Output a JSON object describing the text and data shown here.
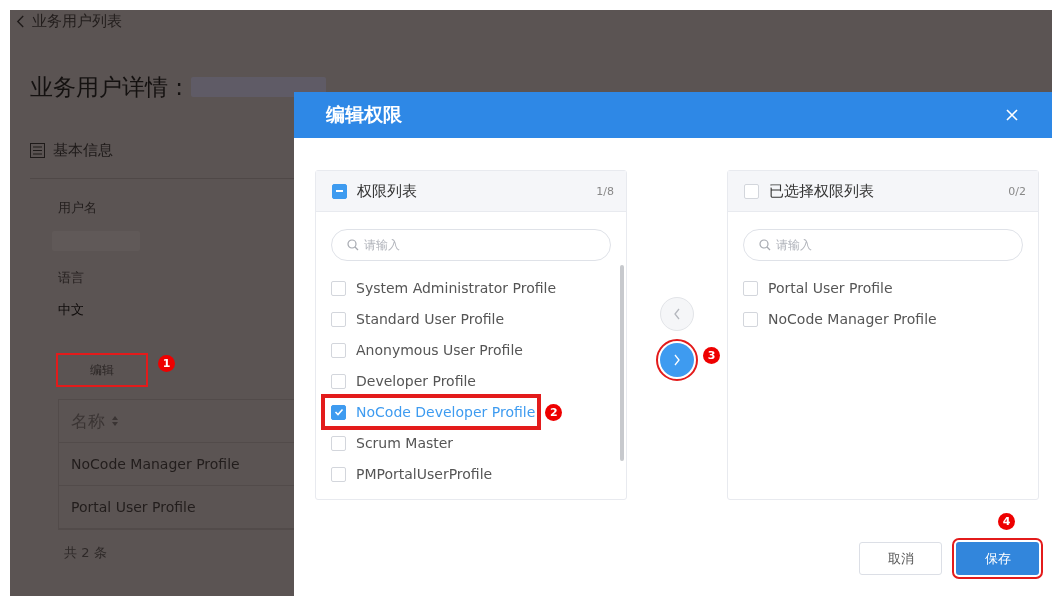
{
  "page": {
    "back_link": "业务用户列表",
    "title": "业务用户详情 :",
    "section": "基本信息",
    "fields": [
      {
        "label": "用户名"
      },
      {
        "label": "语言",
        "value": "中文"
      }
    ],
    "edit_button": {
      "label": "编辑",
      "highlighted": true,
      "callout": "1"
    },
    "table": {
      "columns": [
        "名称"
      ],
      "rows": [
        [
          "NoCode Manager Profile"
        ],
        [
          "Portal User Profile"
        ]
      ]
    },
    "total": "共 2 条"
  },
  "dialog": {
    "title": "编辑权限",
    "panels": [
      {
        "title": "权限列表",
        "count": "1/8",
        "header_partial": true,
        "placeholder": "请输入",
        "scrollbar": true,
        "items": [
          {
            "label": "System Administrator Profile",
            "checked": false,
            "highlighted": false
          },
          {
            "label": "Standard User Profile",
            "checked": false,
            "highlighted": false
          },
          {
            "label": "Anonymous User Profile",
            "checked": false,
            "highlighted": false
          },
          {
            "label": "Developer Profile",
            "checked": false,
            "highlighted": false
          },
          {
            "label": "NoCode Developer Profile",
            "checked": true,
            "highlighted": true,
            "callout": "2"
          },
          {
            "label": "Scrum Master",
            "checked": false,
            "highlighted": false
          },
          {
            "label": "PMPortalUserProfile",
            "checked": false,
            "highlighted": false
          }
        ]
      },
      {
        "title": "已选择权限列表",
        "count": "0/2",
        "header_partial": false,
        "placeholder": "请输入",
        "scrollbar": false,
        "items": [
          {
            "label": "Portal User Profile",
            "checked": false,
            "highlighted": false
          },
          {
            "label": "NoCode Manager Profile",
            "checked": false,
            "highlighted": false
          }
        ]
      }
    ],
    "transfer_buttons": [
      {
        "kind": "left",
        "disabled": true,
        "highlighted": false
      },
      {
        "kind": "right",
        "disabled": false,
        "highlighted": true,
        "callout": "3"
      }
    ],
    "footer_buttons": [
      {
        "label": "取消",
        "kind": "default",
        "highlighted": false
      },
      {
        "label": "保存",
        "kind": "primary",
        "highlighted": true,
        "callout": "4"
      }
    ]
  }
}
